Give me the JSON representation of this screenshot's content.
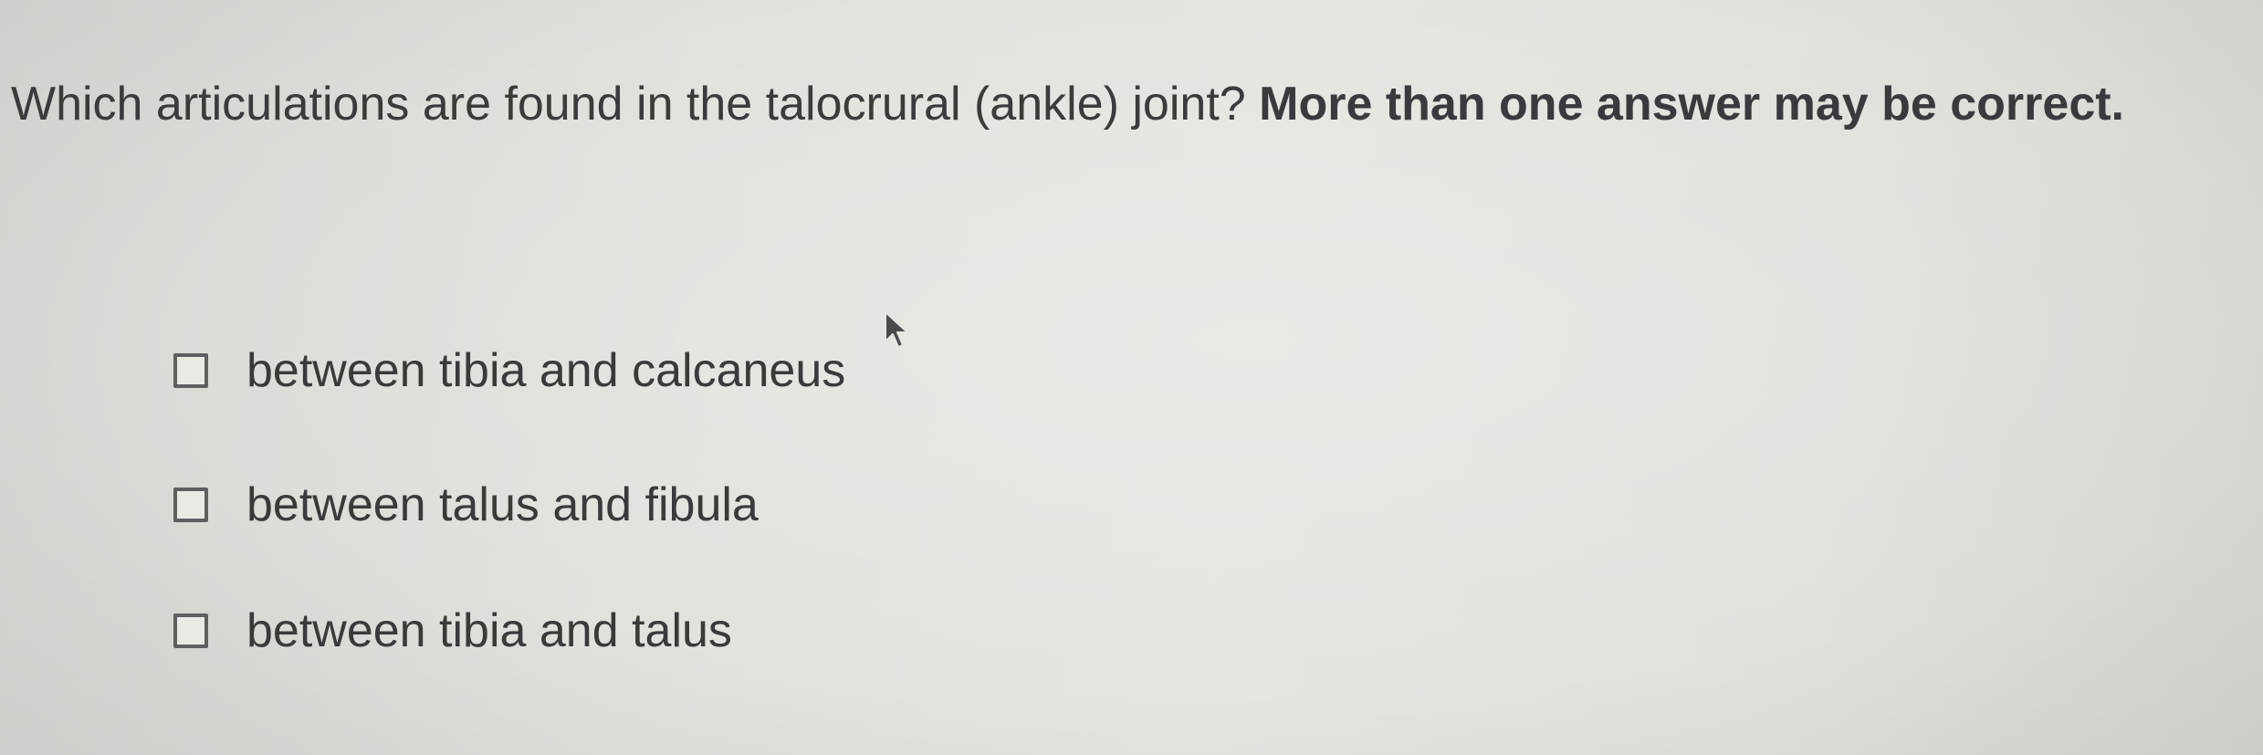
{
  "question": {
    "text": "Which articulations are found in the talocrural (ankle) joint?",
    "emphasis": "More than one answer may be correct."
  },
  "options": [
    {
      "label": "between tibia and calcaneus",
      "checked": false
    },
    {
      "label": "between talus and fibula",
      "checked": false
    },
    {
      "label": "between tibia and talus",
      "checked": false
    }
  ],
  "icons": {
    "cursor": "mouse-pointer-icon"
  }
}
